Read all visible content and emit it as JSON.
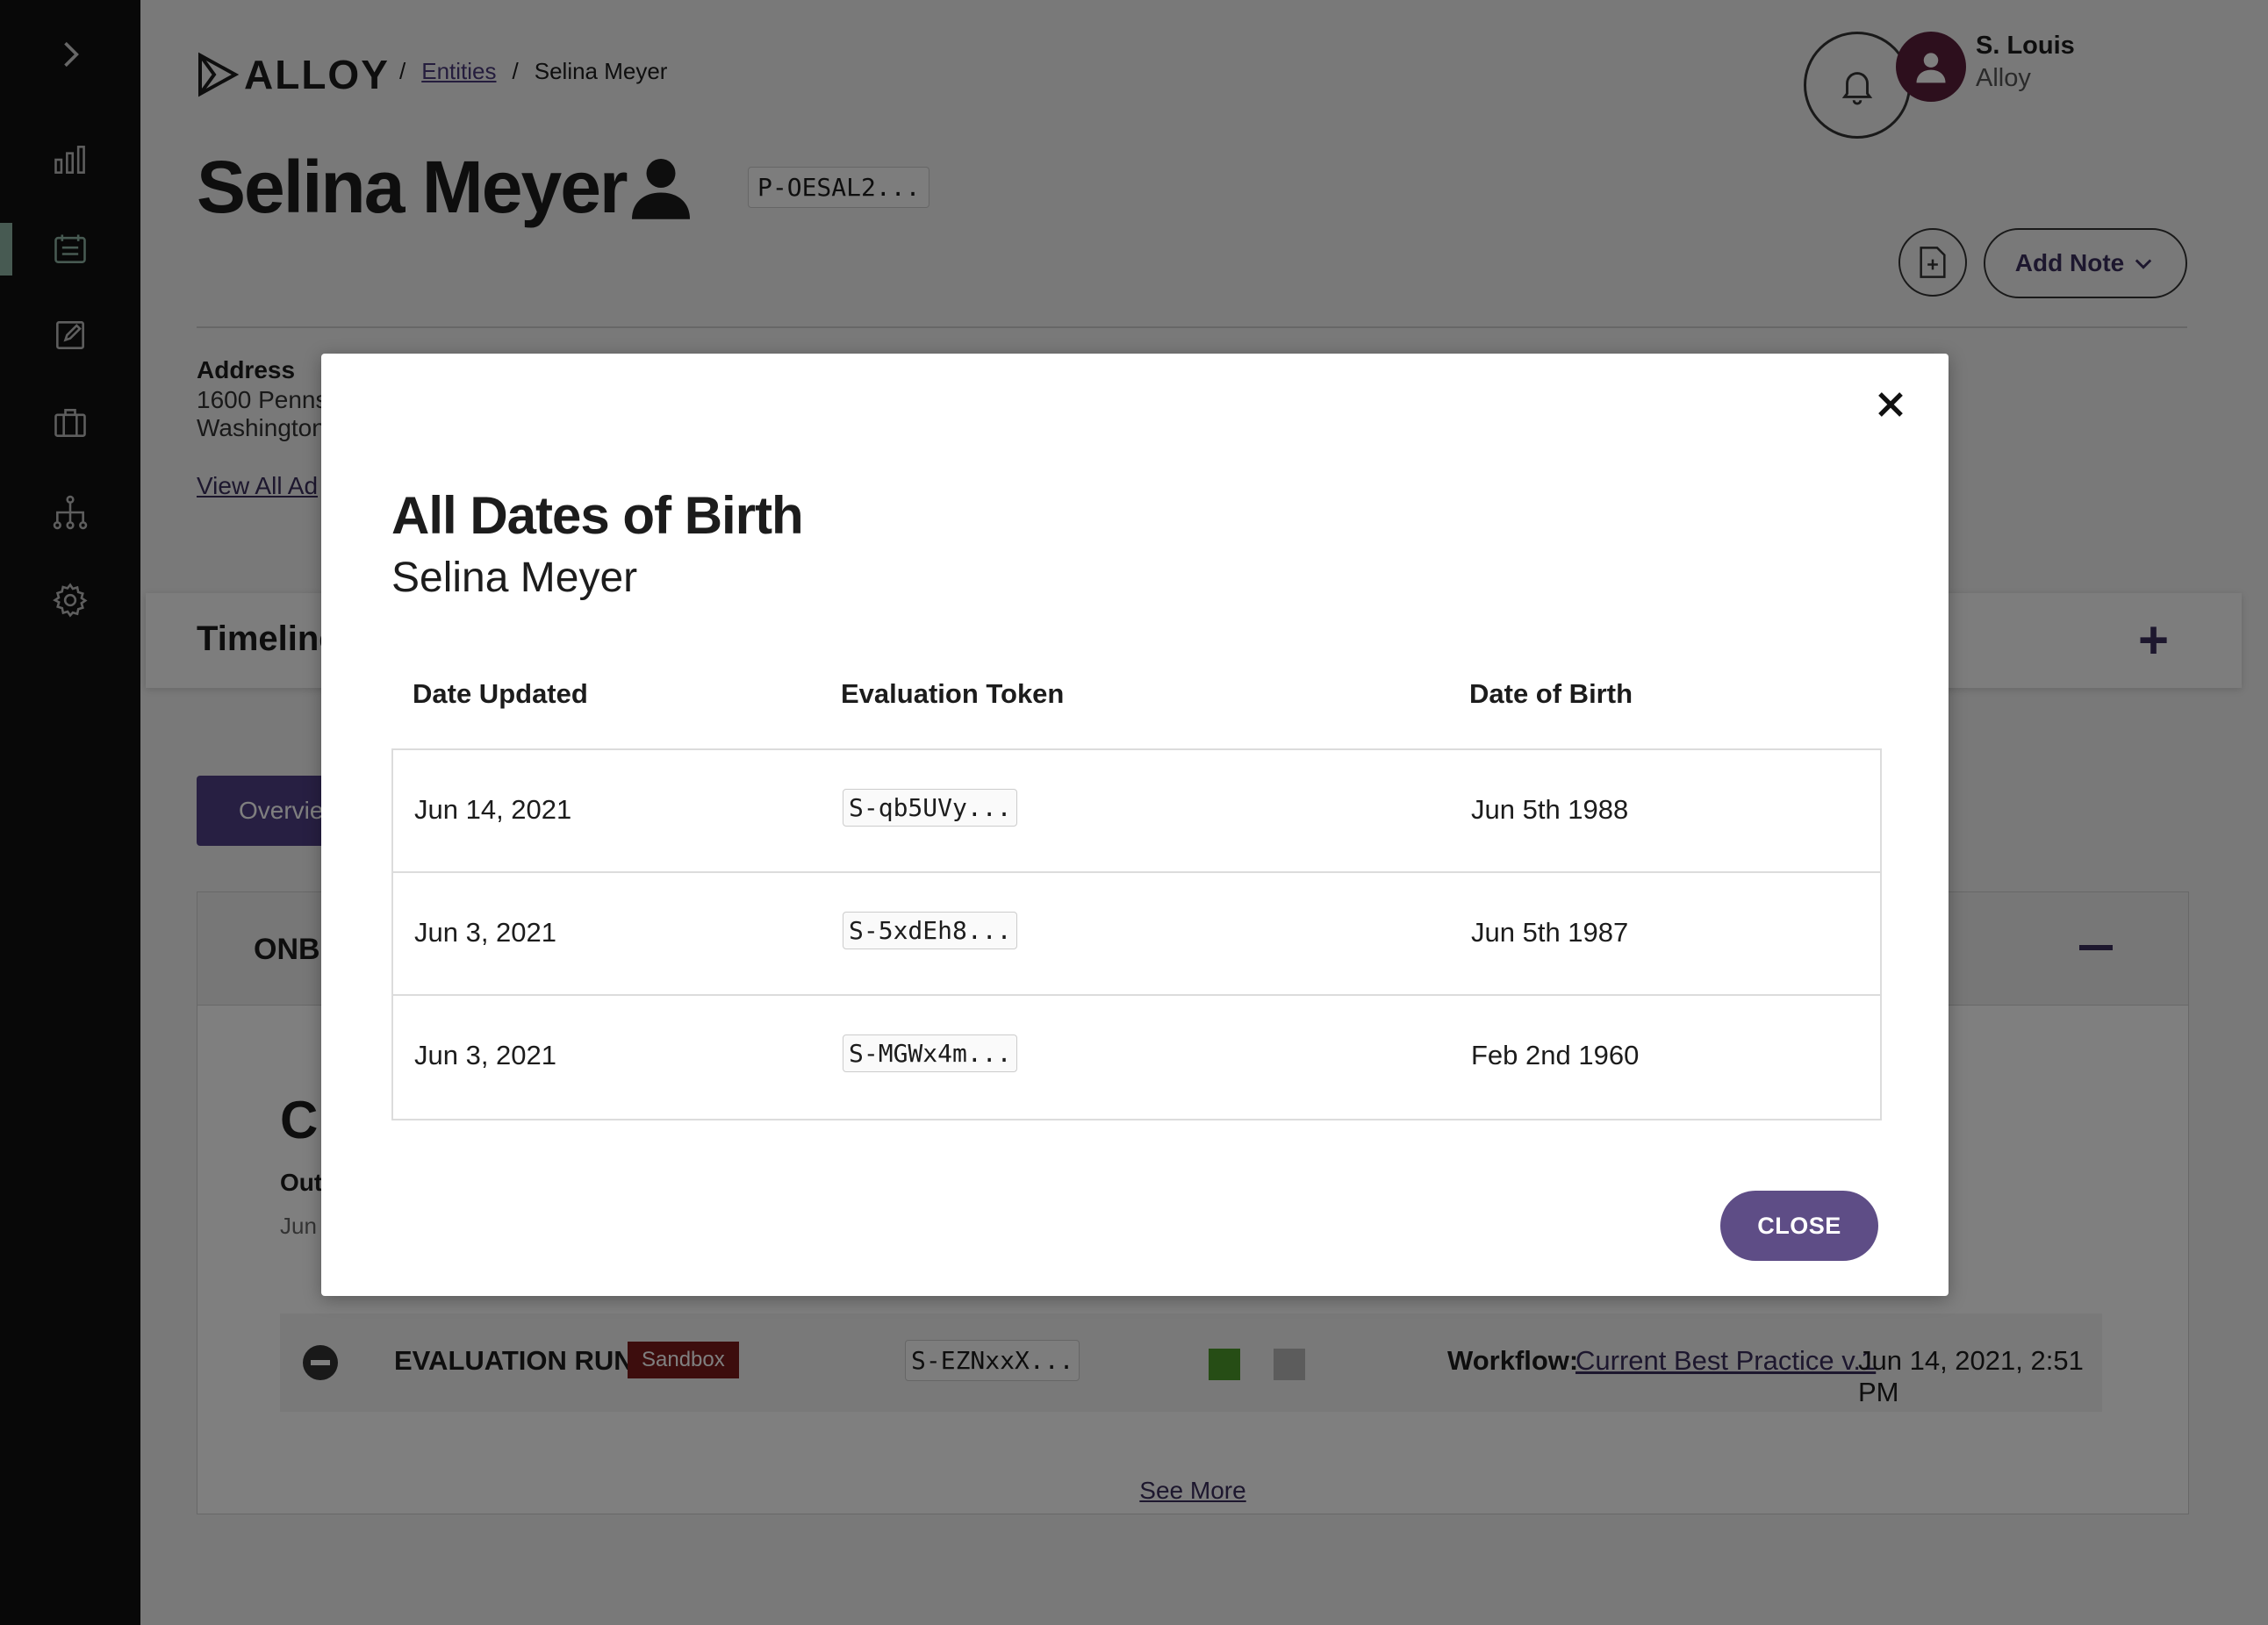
{
  "sidebar": {
    "icons": [
      "chevron-right-icon",
      "bar-chart-icon",
      "list-icon",
      "edit-icon",
      "briefcase-icon",
      "hierarchy-icon",
      "gear-icon"
    ],
    "active_color": "#8fb5a5"
  },
  "header": {
    "logo_text": "ALLOY",
    "breadcrumbs": [
      "Entities",
      "Selina Meyer"
    ],
    "user_name": "S. Louis",
    "user_org": "Alloy"
  },
  "entity": {
    "name": "Selina Meyer",
    "token": "P-OESAL2...",
    "add_note_label": "Add Note",
    "address_label": "Address",
    "address_lines": [
      "1600 Penns",
      "Washington"
    ],
    "view_all_label": "View All Ad"
  },
  "timeline": {
    "title": "Timeline"
  },
  "tabs": {
    "overview_label": "Overvie"
  },
  "onboarding": {
    "title": "ONB",
    "big_text": "C",
    "out_label": "Out",
    "date_prefix": "Jun",
    "evaluation": {
      "label": "EVALUATION RUN",
      "badge": "Sandbox",
      "token": "S-EZNxxX...",
      "workflow_label": "Workflow:",
      "workflow_link": "Current Best Practice v.1",
      "timestamp": "Jun 14, 2021, 2:51 PM"
    },
    "see_more_label": "See More"
  },
  "modal": {
    "title": "All Dates of Birth",
    "subtitle": "Selina Meyer",
    "columns": [
      "Date Updated",
      "Evaluation Token",
      "Date of Birth"
    ],
    "rows": [
      {
        "date_updated": "Jun 14, 2021",
        "token": "S-qb5UVy...",
        "dob": "Jun 5th 1988"
      },
      {
        "date_updated": "Jun 3, 2021",
        "token": "S-5xdEh8...",
        "dob": "Jun 5th 1987"
      },
      {
        "date_updated": "Jun 3, 2021",
        "token": "S-MGWx4m...",
        "dob": "Feb 2nd 1960"
      }
    ],
    "close_label": "CLOSE",
    "accent": "#5e4d86"
  }
}
